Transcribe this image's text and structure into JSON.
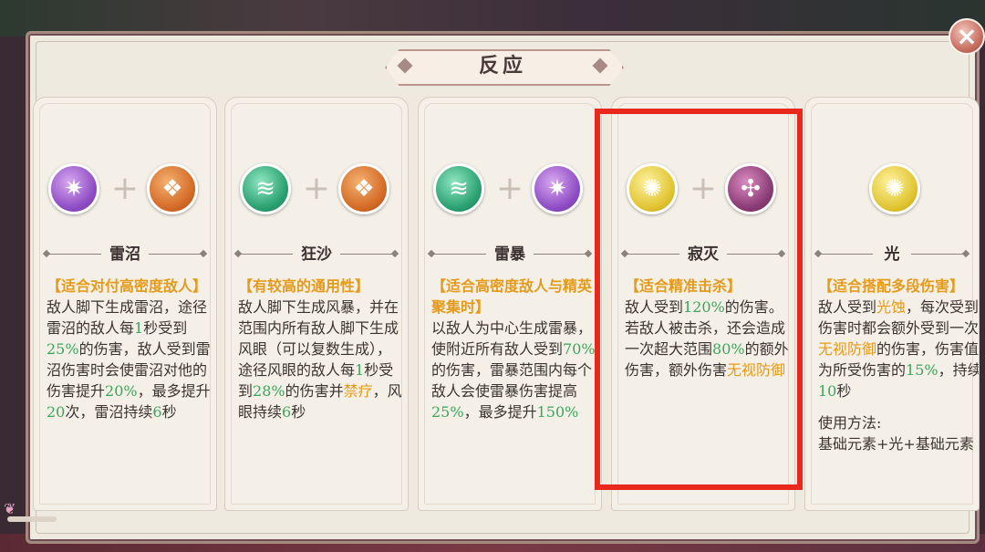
{
  "title": "反应",
  "close_label": "×",
  "cards": [
    {
      "name": "雷沼",
      "icons": [
        "purple-lightning-icon",
        "orange-rock-icon"
      ],
      "tag": "【适合对付高密度敌人】",
      "desc_parts": [
        {
          "t": "敌人脚下生成雷沼，途径雷沼的敌人每"
        },
        {
          "t": "1",
          "c": "g"
        },
        {
          "t": "秒受到"
        },
        {
          "t": "25%",
          "c": "g"
        },
        {
          "t": "的伤害，敌人受到雷沼伤害时会使雷沼对他的伤害提升"
        },
        {
          "t": "20%",
          "c": "g"
        },
        {
          "t": "，最多提升"
        },
        {
          "t": "20",
          "c": "g"
        },
        {
          "t": "次，雷沼持续"
        },
        {
          "t": "6",
          "c": "g"
        },
        {
          "t": "秒"
        }
      ]
    },
    {
      "name": "狂沙",
      "icons": [
        "green-wind-icon",
        "orange-rock-icon"
      ],
      "tag": "【有较高的通用性】",
      "desc_parts": [
        {
          "t": "敌人脚下生成风暴，并在范围内所有敌人脚下生成风眼（可以复数生成），途径风眼的敌人每"
        },
        {
          "t": "1",
          "c": "g"
        },
        {
          "t": "秒受到"
        },
        {
          "t": "28%",
          "c": "g"
        },
        {
          "t": "的伤害并"
        },
        {
          "t": "禁疗",
          "c": "o"
        },
        {
          "t": "，风眼持续"
        },
        {
          "t": "6",
          "c": "g"
        },
        {
          "t": "秒"
        }
      ]
    },
    {
      "name": "雷暴",
      "icons": [
        "green-wind-icon",
        "purple-lightning-icon"
      ],
      "tag": "【适合高密度敌人与精英聚集时】",
      "desc_parts": [
        {
          "t": "以敌人为中心生成雷暴，使附近所有敌人受到"
        },
        {
          "t": "70%",
          "c": "g"
        },
        {
          "t": "的伤害，雷暴范围内每个敌人会使雷暴伤害提高"
        },
        {
          "t": "25%",
          "c": "g"
        },
        {
          "t": "，最多提升"
        },
        {
          "t": "150%",
          "c": "g"
        }
      ]
    },
    {
      "name": "寂灭",
      "icons": [
        "yellow-light-icon",
        "purple-void-icon"
      ],
      "tag": "【适合精准击杀】",
      "desc_parts": [
        {
          "t": "敌人受到"
        },
        {
          "t": "120%",
          "c": "g"
        },
        {
          "t": "的伤害。若敌人被击杀，还会造成一次超大范围"
        },
        {
          "t": "80%",
          "c": "g"
        },
        {
          "t": "的额外伤害，额外伤害"
        },
        {
          "t": "无视防御",
          "c": "o"
        }
      ]
    },
    {
      "name": "光",
      "icons": [
        "yellow-light-icon"
      ],
      "tag": "【适合搭配多段伤害】",
      "desc_parts": [
        {
          "t": "敌人受到"
        },
        {
          "t": "光蚀",
          "c": "o"
        },
        {
          "t": "，每次受到伤害时都会额外受到一次"
        },
        {
          "t": "无视防御",
          "c": "o"
        },
        {
          "t": "的伤害，伤害值为所受伤害的"
        },
        {
          "t": "15%",
          "c": "g"
        },
        {
          "t": "，持续"
        },
        {
          "t": "10",
          "c": "g"
        },
        {
          "t": "秒"
        }
      ],
      "usage_label": "使用方法:",
      "usage_text": "基础元素+光+基础元素"
    }
  ],
  "colors": {
    "number": "#3aa65a",
    "keyword": "#e49a1a",
    "highlight_box": "#e8271d"
  }
}
